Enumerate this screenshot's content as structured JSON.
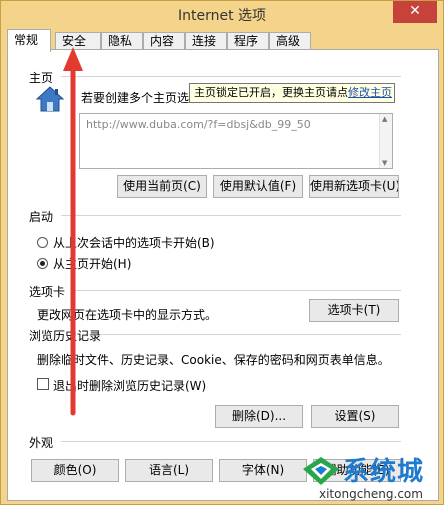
{
  "window": {
    "title": "Internet 选项",
    "close_label": "✕"
  },
  "tabs": [
    {
      "label": "常规",
      "active": true
    },
    {
      "label": "安全",
      "active": false
    },
    {
      "label": "隐私",
      "active": false
    },
    {
      "label": "内容",
      "active": false
    },
    {
      "label": "连接",
      "active": false
    },
    {
      "label": "程序",
      "active": false
    },
    {
      "label": "高级",
      "active": false
    }
  ],
  "homepage": {
    "section_label": "主页",
    "description": "若要创建多个主页选项",
    "url_value": "http://www.duba.com/?f=dbsj&db_99_50",
    "tooltip_text": "主页锁定已开启，更换主页请点",
    "tooltip_link": "修改主页",
    "buttons": {
      "use_current": "使用当前页(C)",
      "use_default": "使用默认值(F)",
      "use_new_tab": "使用新选项卡(U)"
    }
  },
  "startup": {
    "section_label": "启动",
    "option_last_session": "从上次会话中的选项卡开始(B)",
    "option_homepage": "从主页开始(H)",
    "selected": "option_homepage"
  },
  "tabs_section": {
    "section_label": "选项卡",
    "description": "更改网页在选项卡中的显示方式。",
    "button": "选项卡(T)"
  },
  "history": {
    "section_label": "浏览历史记录",
    "description": "删除临时文件、历史记录、Cookie、保存的密码和网页表单信息。",
    "checkbox_label": "退出时删除浏览历史记录(W)",
    "checkbox_checked": false,
    "delete_button": "删除(D)...",
    "settings_button": "设置(S)"
  },
  "appearance": {
    "section_label": "外观",
    "colors_button": "颜色(O)",
    "languages_button": "语言(L)",
    "fonts_button": "字体(N)",
    "accessibility_button": "辅助功能(E)"
  },
  "watermark": {
    "brand": "系统城",
    "url": "xitongcheng.com"
  },
  "colors": {
    "titlebar": "#f4d48b",
    "close": "#c8423c",
    "arrow": "#e23a2f",
    "link": "#1a4fb0"
  }
}
